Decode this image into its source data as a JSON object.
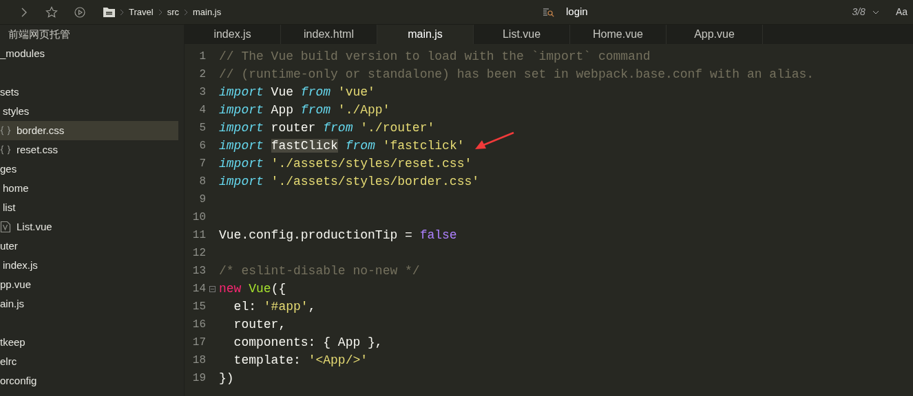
{
  "toolbar": {
    "breadcrumb": [
      "Travel",
      "src",
      "main.js"
    ]
  },
  "search": {
    "value": "login",
    "count": "3/8",
    "case_toggle": "Aa"
  },
  "sidebar": {
    "title": "前端网页托管",
    "items": [
      {
        "label": "_modules",
        "selected": false
      },
      {
        "kind": "blank",
        "children": [
          {
            "label": "sets",
            "selected": false,
            "children": [
              {
                "label": "styles",
                "selected": false,
                "children": [
                  {
                    "label": "border.css",
                    "kind": "css",
                    "selected": true
                  },
                  {
                    "label": "reset.css",
                    "kind": "css",
                    "selected": false
                  }
                ]
              }
            ]
          },
          {
            "label": "ges",
            "selected": false,
            "children": [
              {
                "label": "home",
                "selected": false
              },
              {
                "label": "list",
                "selected": false,
                "children": [
                  {
                    "label": "List.vue",
                    "kind": "vue",
                    "selected": false
                  }
                ]
              }
            ]
          },
          {
            "label": "uter",
            "selected": false,
            "children": [
              {
                "label": "index.js",
                "selected": false
              }
            ]
          },
          {
            "label": "pp.vue",
            "selected": false
          },
          {
            "label": "ain.js",
            "selected": false
          }
        ]
      },
      {
        "kind": "blank"
      },
      {
        "label": "tkeep",
        "selected": false
      },
      {
        "label": "elrc",
        "selected": false
      },
      {
        "label": "orconfig",
        "selected": false
      }
    ]
  },
  "tabs": [
    {
      "label": "index.js",
      "selected": false
    },
    {
      "label": "index.html",
      "selected": false
    },
    {
      "label": "main.js",
      "selected": true
    },
    {
      "label": "List.vue",
      "selected": false
    },
    {
      "label": "Home.vue",
      "selected": false
    },
    {
      "label": "App.vue",
      "selected": false
    }
  ],
  "code": [
    {
      "number": "1",
      "tokens": [
        {
          "kind": "comment",
          "text": "// The Vue build version to load with the `import` command"
        }
      ]
    },
    {
      "number": "2",
      "tokens": [
        {
          "kind": "comment",
          "text": "// (runtime-only or standalone) has been set in webpack.base.conf with an alias."
        }
      ]
    },
    {
      "number": "3",
      "tokens": [
        {
          "kind": "keyword",
          "text": "import"
        },
        {
          "kind": "plain",
          "text": " Vue "
        },
        {
          "kind": "keyword",
          "text": "from"
        },
        {
          "kind": "string",
          "text": " 'vue'"
        }
      ]
    },
    {
      "number": "4",
      "tokens": [
        {
          "kind": "keyword",
          "text": "import"
        },
        {
          "kind": "plain",
          "text": " App "
        },
        {
          "kind": "keyword",
          "text": "from"
        },
        {
          "kind": "string",
          "text": " './App'"
        }
      ]
    },
    {
      "number": "5",
      "tokens": [
        {
          "kind": "keyword",
          "text": "import"
        },
        {
          "kind": "plain",
          "text": " router "
        },
        {
          "kind": "keyword",
          "text": "from"
        },
        {
          "kind": "string",
          "text": " './router'"
        }
      ]
    },
    {
      "number": "6",
      "annotated": true,
      "tokens": [
        {
          "kind": "keyword",
          "text": "import "
        },
        {
          "kind": "match",
          "text": "fastClick"
        },
        {
          "kind": "keyword",
          "text": " from"
        },
        {
          "kind": "string",
          "text": " 'fastclick'"
        }
      ]
    },
    {
      "number": "7",
      "tokens": [
        {
          "kind": "keyword",
          "text": "import"
        },
        {
          "kind": "string",
          "text": " './assets/styles/reset.css'"
        }
      ]
    },
    {
      "number": "8",
      "tokens": [
        {
          "kind": "keyword",
          "text": "import"
        },
        {
          "kind": "string",
          "text": " './assets/styles/border.css'"
        }
      ]
    },
    {
      "number": "9"
    },
    {
      "number": "10"
    },
    {
      "number": "11",
      "tokens": [
        {
          "kind": "plain",
          "text": "Vue.config.productionTip = "
        },
        {
          "kind": "constant",
          "text": "false"
        }
      ]
    },
    {
      "number": "12"
    },
    {
      "number": "13",
      "tokens": [
        {
          "kind": "comment",
          "text": "/* eslint-disable no-new */"
        }
      ]
    },
    {
      "number": "14",
      "foldable": true,
      "tokens": [
        {
          "kind": "new",
          "text": "new "
        },
        {
          "kind": "class",
          "text": "Vue"
        },
        {
          "kind": "plain",
          "text": "({"
        }
      ]
    },
    {
      "number": "15",
      "tokens": [
        {
          "kind": "plain",
          "text": "  el: "
        },
        {
          "kind": "string",
          "text": "'#app'"
        },
        {
          "kind": "plain",
          "text": ","
        }
      ]
    },
    {
      "number": "16",
      "tokens": [
        {
          "kind": "plain",
          "text": "  router,"
        }
      ]
    },
    {
      "number": "17",
      "tokens": [
        {
          "kind": "plain",
          "text": "  components: { App },"
        }
      ]
    },
    {
      "number": "18",
      "tokens": [
        {
          "kind": "plain",
          "text": "  template: "
        },
        {
          "kind": "string",
          "text": "'<App/>'"
        }
      ]
    },
    {
      "number": "19",
      "tokens": [
        {
          "kind": "plain",
          "text": "})"
        }
      ]
    }
  ]
}
